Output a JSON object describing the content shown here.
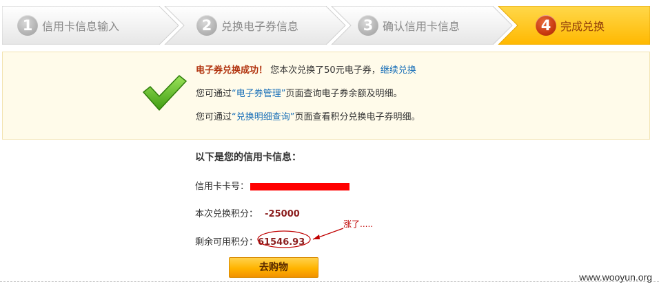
{
  "steps": [
    {
      "num": "1",
      "label": "信用卡信息输入"
    },
    {
      "num": "2",
      "label": "兑换电子券信息"
    },
    {
      "num": "3",
      "label": "确认信用卡信息"
    },
    {
      "num": "4",
      "label": "完成兑换"
    }
  ],
  "success": {
    "title": "电子券兑换成功！",
    "text1": "您本次兑换了50元电子券，",
    "continue_link": "继续兑换",
    "line2_pre": "您可通过",
    "line2_link": "“电子券管理”",
    "line2_post": "页面查询电子券余额及明细。",
    "line3_pre": "您可通过",
    "line3_link": "“兑换明细查询”",
    "line3_post": "页面查看积分兑换电子券明细。"
  },
  "info": {
    "heading": "以下是您的信用卡信息：",
    "card_label": "信用卡卡号：",
    "points_label": "本次兑换积分：",
    "points_value": "-25000",
    "remaining_label": "剩余可用积分：",
    "remaining_value": "61546.93"
  },
  "annotation": "涨了.....",
  "buy_button": "去购物",
  "watermark": "www.wooyun.org",
  "colors": {
    "accent": "#ffb300",
    "success_title": "#b1330e",
    "link": "#1a70b8",
    "redaction": "#ff0000"
  }
}
